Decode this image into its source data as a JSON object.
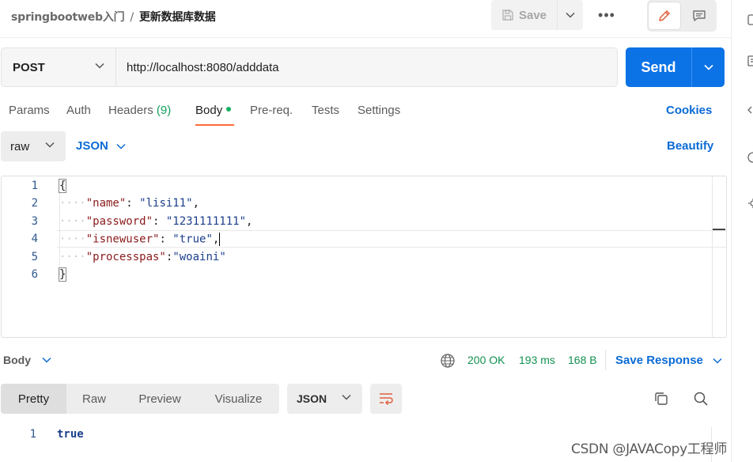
{
  "breadcrumb": {
    "parent": "springbootweb入门",
    "separator": "/",
    "current": "更新数据库数据"
  },
  "toolbar": {
    "save_label": "Save",
    "more_label": "•••"
  },
  "request": {
    "method": "POST",
    "url": "http://localhost:8080/adddata",
    "send_label": "Send"
  },
  "request_tabs": {
    "params": "Params",
    "auth": "Auth",
    "headers": "Headers",
    "headers_count": "(9)",
    "body": "Body",
    "prereq": "Pre-req.",
    "tests": "Tests",
    "settings": "Settings",
    "cookies": "Cookies"
  },
  "body_options": {
    "mode": "raw",
    "language": "JSON",
    "beautify": "Beautify"
  },
  "editor": {
    "line_numbers": [
      "1",
      "2",
      "3",
      "4",
      "5",
      "6"
    ],
    "open_brace": "{",
    "close_brace": "}",
    "entries": [
      {
        "key": "\"name\"",
        "colon": ": ",
        "value": "\"lisi11\"",
        "comma": ","
      },
      {
        "key": "\"password\"",
        "colon": ": ",
        "value": "\"1231111111\"",
        "comma": ","
      },
      {
        "key": "\"isnewuser\"",
        "colon": ": ",
        "value": "\"true\"",
        "comma": ","
      },
      {
        "key": "\"processpas\"",
        "colon": ":",
        "value": "\"woaini\"",
        "comma": ""
      }
    ]
  },
  "response": {
    "section_label": "Body",
    "status": "200 OK",
    "time": "193 ms",
    "size": "168 B",
    "save_response": "Save Response",
    "tabs": {
      "pretty": "Pretty",
      "raw": "Raw",
      "preview": "Preview",
      "visualize": "Visualize"
    },
    "format": "JSON",
    "line_number": "1",
    "value": "true"
  },
  "watermark": "CSDN @JAVACopy工程师",
  "colors": {
    "accent": "#0b73e6",
    "tab_indicator": "#ff6c37",
    "success": "#12914f"
  },
  "icons": [
    "save-icon",
    "chevron-down-icon",
    "more-icon",
    "edit-icon",
    "comment-icon",
    "globe-icon",
    "copy-icon",
    "search-icon",
    "wrap-icon"
  ]
}
